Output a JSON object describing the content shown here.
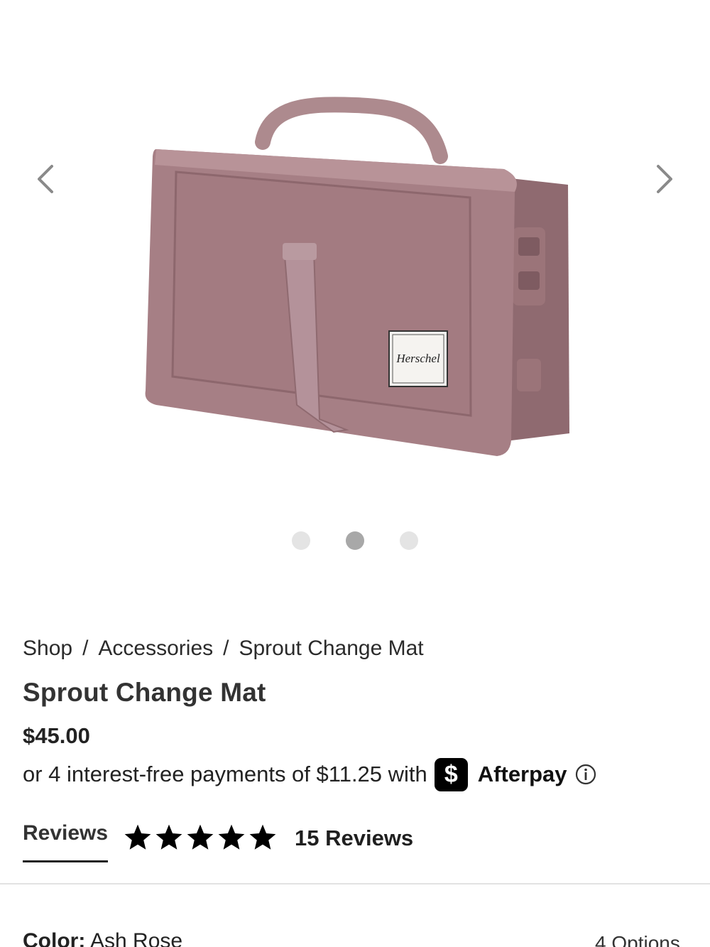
{
  "carousel": {
    "prev_icon": "chevron-left-icon",
    "next_icon": "chevron-right-icon",
    "slide_count": 3,
    "active_slide": 2,
    "brand_tag": "Herschel"
  },
  "breadcrumb": {
    "items": [
      "Shop",
      "Accessories",
      "Sprout Change Mat"
    ],
    "separator": "/"
  },
  "product": {
    "title": "Sprout Change Mat",
    "price": "$45.00",
    "installment_text": "or 4 interest-free payments of $11.25 with",
    "afterpay_badge": "$",
    "afterpay_name": "Afterpay"
  },
  "reviews": {
    "tab_label": "Reviews",
    "rating": 5,
    "rating_max": 5,
    "count_label": "15 Reviews"
  },
  "color": {
    "label": "Color:",
    "value": "Ash Rose",
    "options_label": "4 Options"
  },
  "colors": {
    "product": "#a37d82",
    "star": "#000000",
    "dot_active": "#a8a8a8",
    "dot_inactive": "#e4e4e4"
  }
}
